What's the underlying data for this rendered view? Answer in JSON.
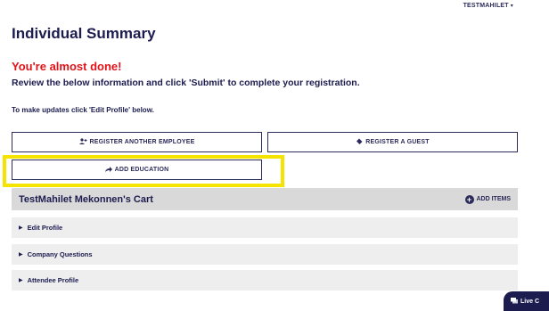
{
  "header": {
    "user_menu_label": "TESTMAHILET",
    "user_menu_icon": "caret-down-icon"
  },
  "page": {
    "title": "Individual Summary",
    "alert": "You're almost done!",
    "instructions": "Review the below information and click 'Submit' to complete your registration.",
    "update_hint": "To make updates click 'Edit Profile' below."
  },
  "actions": {
    "register_employee_label": "REGISTER ANOTHER EMPLOYEE",
    "register_employee_icon": "user-plus-icon",
    "register_guest_label": "REGISTER A GUEST",
    "register_guest_icon": "ticket-icon",
    "add_education_label": "ADD EDUCATION",
    "add_education_icon": "share-arrow-icon"
  },
  "cart": {
    "title": "TestMahilet Mekonnen's Cart",
    "add_items_label": "ADD ITEMS",
    "add_items_icon": "plus-circle-icon"
  },
  "sections": [
    {
      "label": "Edit Profile"
    },
    {
      "label": "Company Questions"
    },
    {
      "label": "Attendee Profile"
    }
  ],
  "chat": {
    "label": "Live C",
    "icon": "chat-icon"
  },
  "colors": {
    "navy": "#1c1c4f",
    "alert_red": "#e0141a",
    "highlight_yellow": "#f5e400",
    "cart_header_bg": "#d9d9d9",
    "section_bg": "#eeeeee"
  }
}
